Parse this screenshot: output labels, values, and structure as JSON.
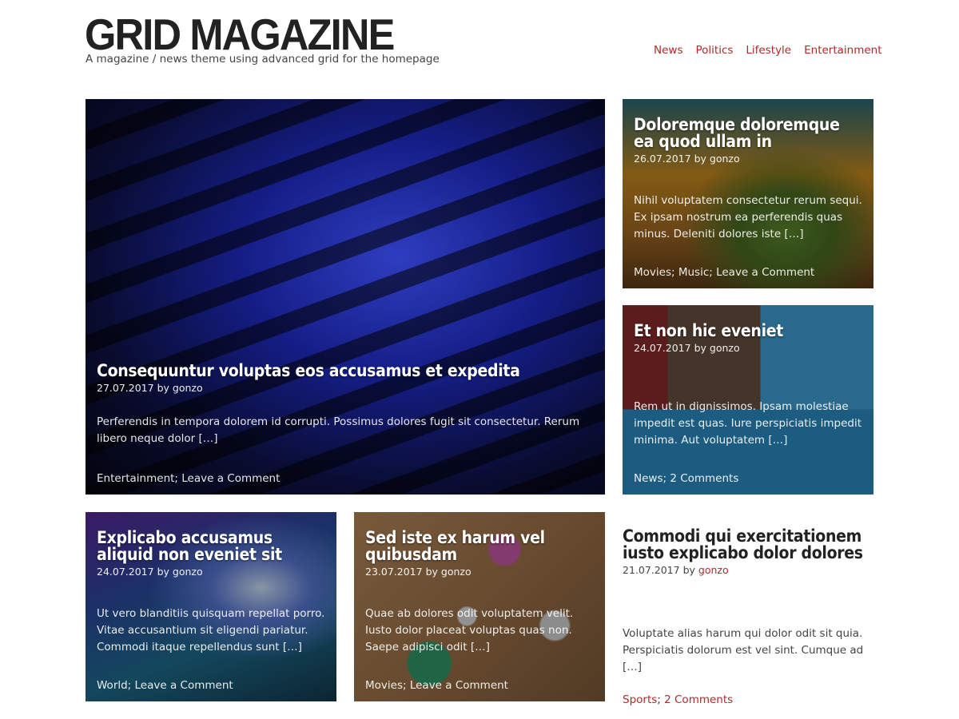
{
  "site": {
    "title": "GRID MAGAZINE",
    "tagline": "A magazine / news theme using advanced grid for the homepage"
  },
  "nav": [
    "News",
    "Politics",
    "Lifestyle",
    "Entertainment"
  ],
  "colors": {
    "accent": "#b02a2a",
    "text": "#333333",
    "title": "#222222"
  },
  "posts": [
    {
      "title": "Consequuntur voluptas eos accusamus et expedita",
      "date": "27.07.2017",
      "by": "by",
      "author": "gonzo",
      "excerpt": "Perferendis in tempora dolorem id corrupti. Possimus dolores fugit sit consectetur. Rerum libero neque dolor […]",
      "footer": "Entertainment; Leave a Comment"
    },
    {
      "title": "Doloremque doloremque ea quod ullam in",
      "date": "26.07.2017",
      "by": "by",
      "author": "gonzo",
      "excerpt": "Nihil voluptatem consectetur rerum sequi. Ex ipsam nostrum ea perferendis quas minus. Deleniti dolores iste […]",
      "footer": "Movies; Music; Leave a Comment"
    },
    {
      "title": "Et non hic eveniet",
      "date": "24.07.2017",
      "by": "by",
      "author": "gonzo",
      "excerpt": "Rem ut in dignissimos. Ipsam molestiae impedit est quas. Iure perspiciatis impedit minima. Aut voluptatem […]",
      "footer": "News; 2 Comments"
    },
    {
      "title": "Explicabo accusamus aliquid non eveniet sit",
      "date": "24.07.2017",
      "by": "by",
      "author": "gonzo",
      "excerpt": "Ut vero blanditiis quisquam repellat porro. Vitae accusantium sit eligendi pariatur. Commodi itaque repellendus sunt […]",
      "footer": "World; Leave a Comment"
    },
    {
      "title": "Sed iste ex harum vel quibusdam",
      "date": "23.07.2017",
      "by": "by",
      "author": "gonzo",
      "excerpt": "Quae ab dolores odit voluptatem velit. Iusto dolor placeat voluptas quas non. Saepe adipisci odit […]",
      "footer": "Movies; Leave a Comment"
    },
    {
      "title": "Commodi qui exercitationem iusto explicabo dolor dolores",
      "date": "21.07.2017",
      "by": "by",
      "author": "gonzo",
      "excerpt": "Voluptate alias harum qui dolor odit sit quia. Perspiciatis dolorum est vel sint. Cumque ad […]",
      "category": "Sports",
      "comments": "2 Comments"
    }
  ]
}
